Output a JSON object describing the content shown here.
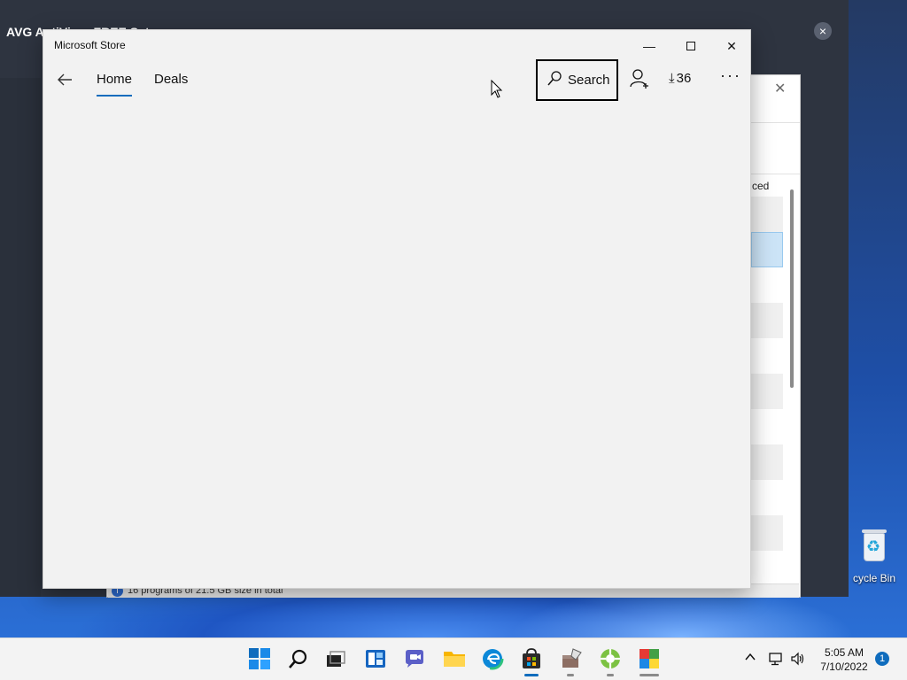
{
  "background_window": {
    "title": "AVG AntiVirus FREE Setup",
    "close_symbol": "×"
  },
  "programs_window": {
    "column_header_fragment": "ced",
    "status_text": "16 programs of 21.5 GB size in total"
  },
  "desktop": {
    "recycle_bin_label": "cycle Bin"
  },
  "store": {
    "title": "Microsoft Store",
    "nav": {
      "back_icon": "arrow-left-icon",
      "tabs": [
        {
          "label": "Home",
          "active": true
        },
        {
          "label": "Deals",
          "active": false
        }
      ]
    },
    "toolbar": {
      "search_label": "Search",
      "downloads_count": "36",
      "more_label": "···"
    },
    "window_controls": {
      "minimize": "—",
      "close": "✕"
    }
  },
  "taskbar": {
    "apps": [
      {
        "name": "start",
        "active": false
      },
      {
        "name": "search",
        "active": false
      },
      {
        "name": "task-view",
        "active": false
      },
      {
        "name": "widgets",
        "active": false
      },
      {
        "name": "chat",
        "active": false
      },
      {
        "name": "file-explorer",
        "active": false
      },
      {
        "name": "edge",
        "active": false
      },
      {
        "name": "microsoft-store",
        "active": true
      },
      {
        "name": "installer",
        "active": false
      },
      {
        "name": "setup",
        "active": false
      },
      {
        "name": "avg",
        "active": false
      }
    ],
    "tray": {
      "chevron": "^",
      "time": "5:05 AM",
      "date": "7/10/2022",
      "notification_count": "1"
    }
  },
  "colors": {
    "accent": "#0f6cbd",
    "store_bg": "#f2f2f2",
    "avg_bg": "#2e3440"
  }
}
